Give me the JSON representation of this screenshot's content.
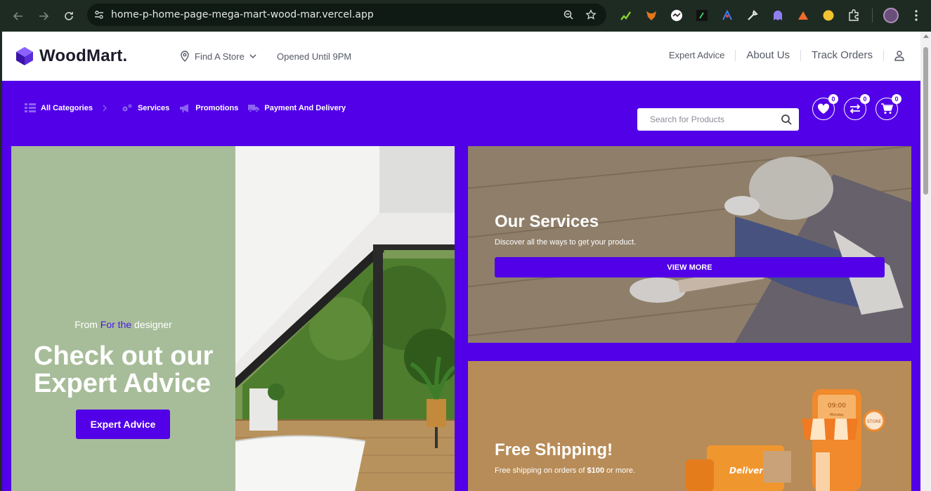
{
  "browser": {
    "url": "home-p-home-page-mega-mart-wood-mar.vercel.app",
    "extensions": [
      "chart-extension-icon",
      "fox-extension-icon",
      "dots-extension-icon",
      "terminal-extension-icon",
      "graph-extension-icon",
      "eyedropper-extension-icon",
      "ghost-extension-icon",
      "mountain-extension-icon",
      "coin-extension-icon",
      "puzzle-icon"
    ]
  },
  "header": {
    "logo_text": "WoodMart.",
    "find_store": "Find A Store",
    "opened": "Opened Until 9PM",
    "links": [
      "Expert Advice",
      "About Us",
      "Track Orders"
    ]
  },
  "nav": {
    "items": [
      "All Categories",
      "Services",
      "Promotions",
      "Payment And Delivery"
    ],
    "search_placeholder": "Search for Products",
    "wishlist_count": "0",
    "compare_count": "0",
    "cart_count": "0"
  },
  "hero": {
    "kicker_pre": "From ",
    "kicker_hl": "For the",
    "kicker_post": " designer",
    "title": "Check out our Expert Advice",
    "button": "Expert Advice"
  },
  "services_card": {
    "title": "Our Services",
    "subtitle": "Discover all the ways to get your product.",
    "button": "VIEW MORE"
  },
  "shipping_card": {
    "title": "Free Shipping!",
    "subtitle_pre": "Free shipping on orders of ",
    "subtitle_amount": "$100",
    "subtitle_post": " or more.",
    "truck_label": "Delivery",
    "store_sign": "STORE",
    "clock_text": "09:00",
    "clock_sub": "Monday"
  },
  "colors": {
    "brand": "#5100e8",
    "hero_bg": "#a7bd99",
    "accent": "#4a19e6"
  }
}
